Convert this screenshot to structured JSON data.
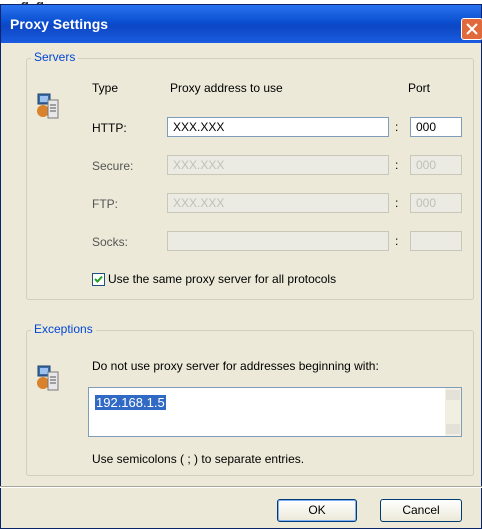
{
  "window": {
    "title": "Proxy Settings",
    "background_title": "...g..g..."
  },
  "servers": {
    "group_label": "Servers",
    "headers": {
      "type": "Type",
      "address": "Proxy address to use",
      "port": "Port"
    },
    "rows": [
      {
        "label": "HTTP:",
        "address": "XXX.XXX",
        "port": "000",
        "enabled": true
      },
      {
        "label": "Secure:",
        "address": "XXX.XXX",
        "port": "000",
        "enabled": false
      },
      {
        "label": "FTP:",
        "address": "XXX.XXX",
        "port": "000",
        "enabled": false
      },
      {
        "label": "Socks:",
        "address": "",
        "port": "",
        "enabled": false
      }
    ],
    "separator": ":",
    "same_proxy_checkbox": {
      "label": "Use the same proxy server for all protocols",
      "checked": true
    }
  },
  "exceptions": {
    "group_label": "Exceptions",
    "instruction": "Do not use proxy server for addresses beginning with:",
    "value": "192.168.1.5",
    "hint": "Use semicolons ( ; ) to separate entries."
  },
  "buttons": {
    "ok": "OK",
    "cancel": "Cancel"
  },
  "colors": {
    "title_bar": "#0a4fd0",
    "group_label": "#0046d5",
    "dialog_bg": "#ece9d8",
    "selection": "#316ac5"
  }
}
